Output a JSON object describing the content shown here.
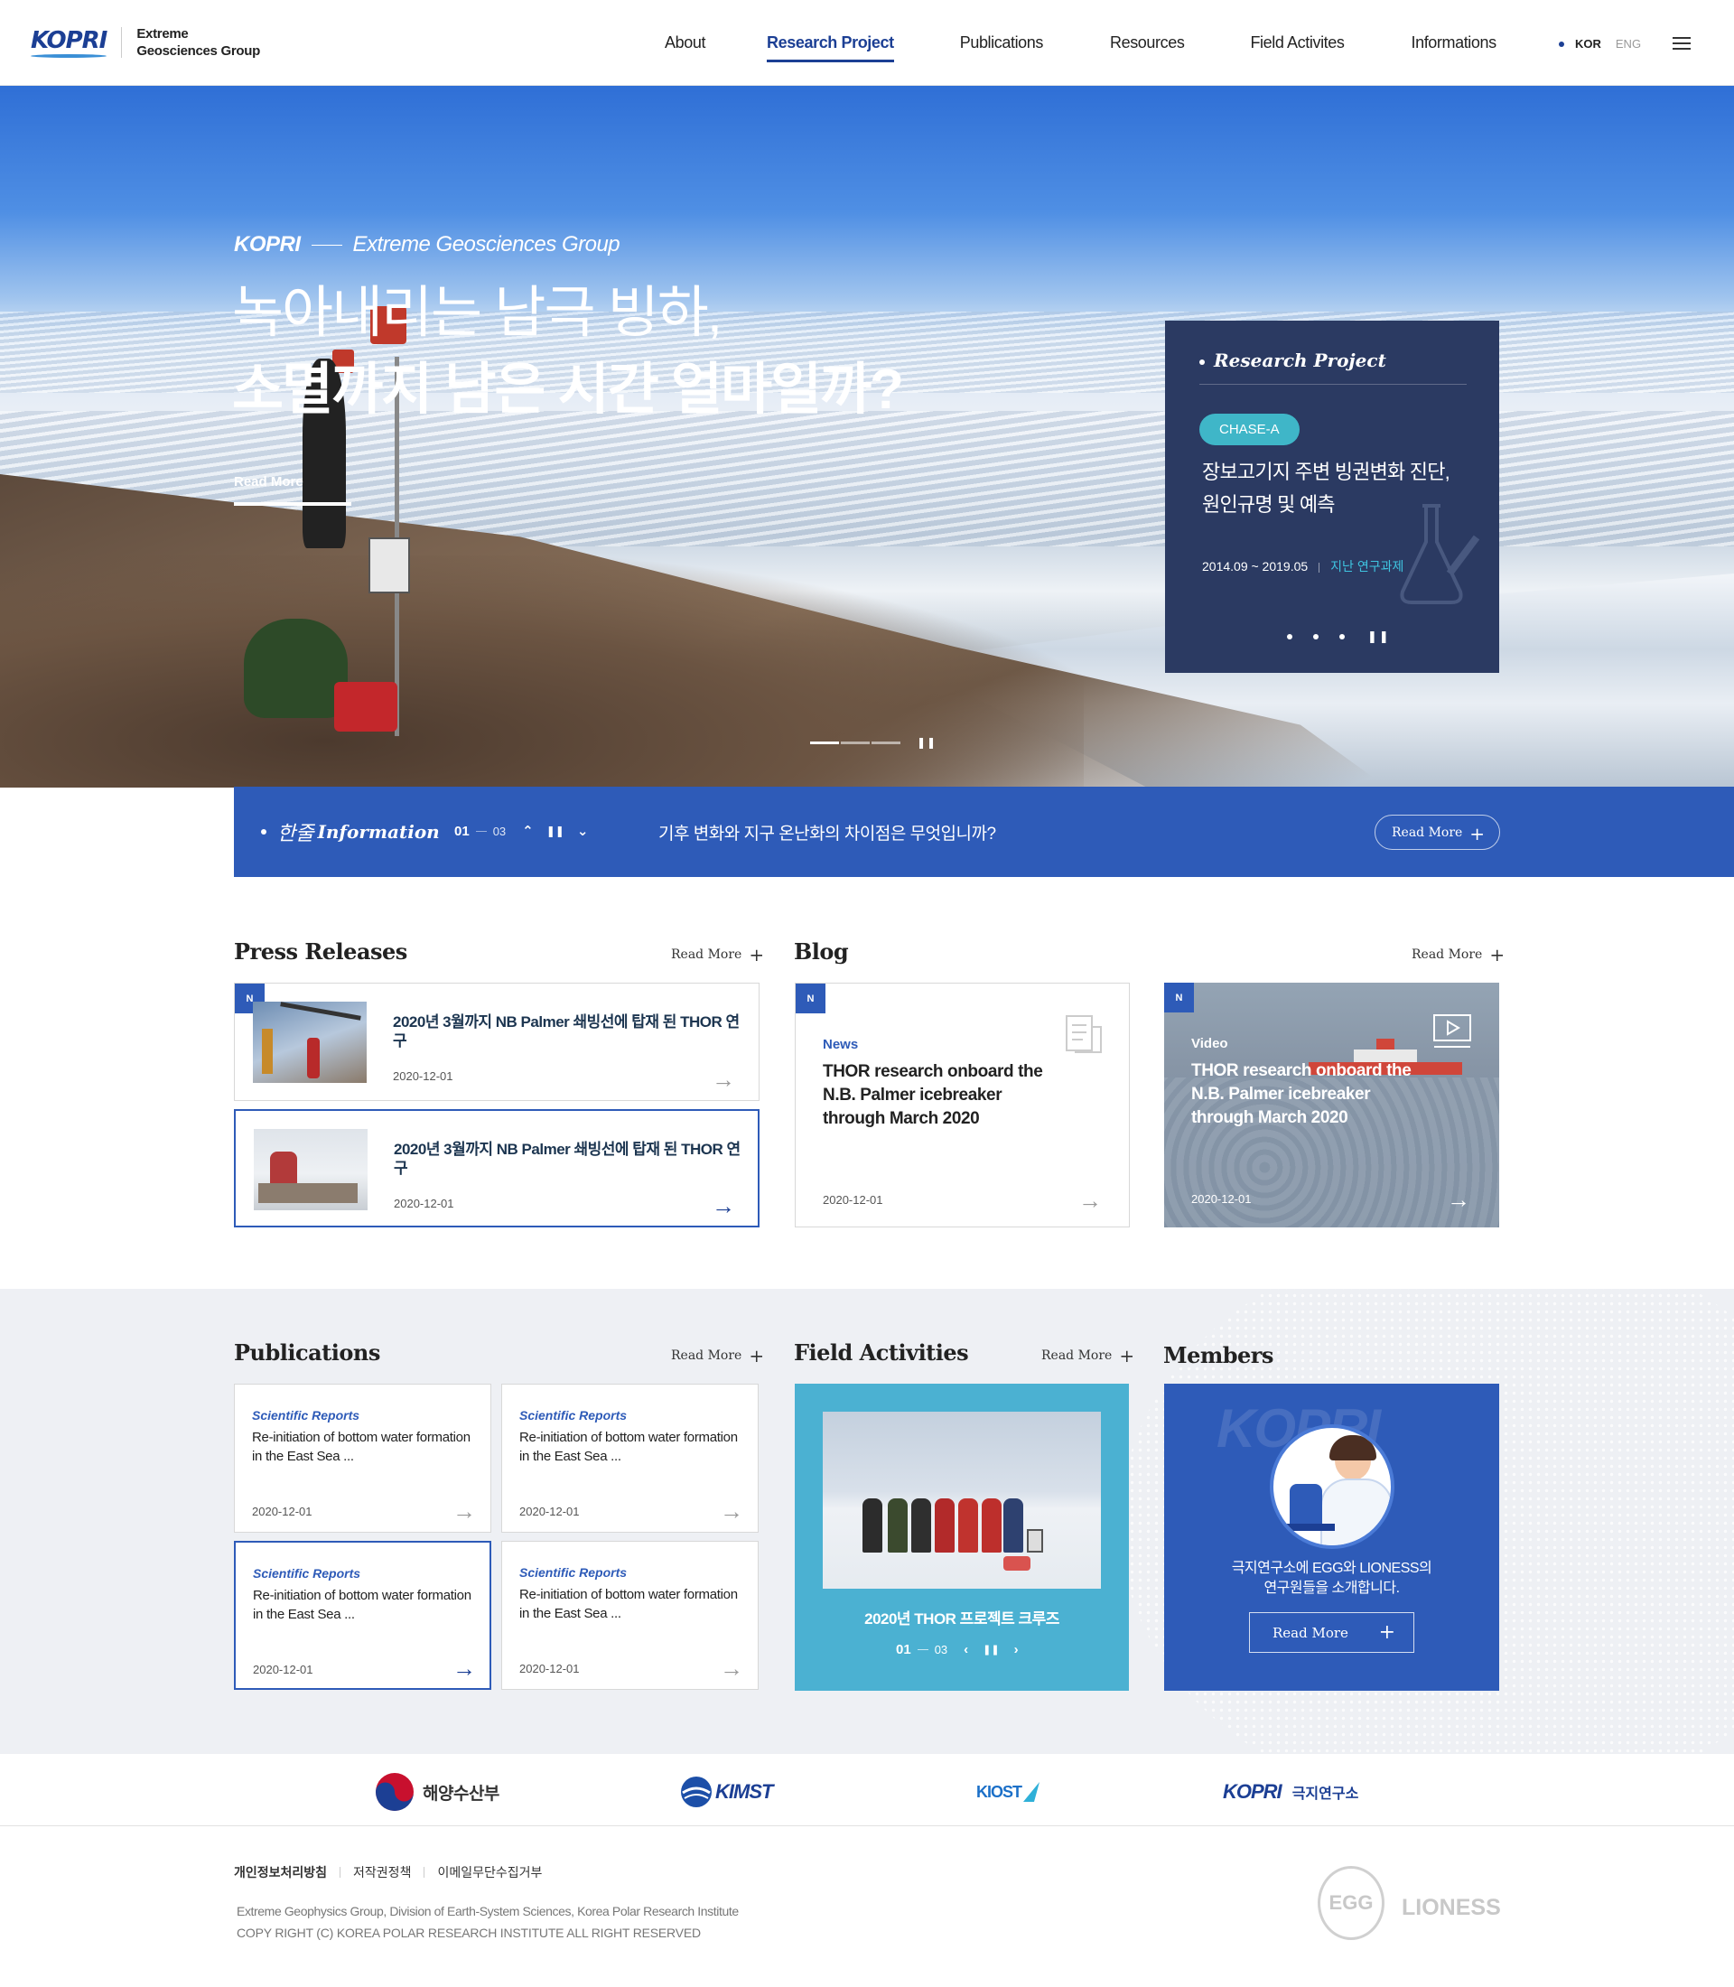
{
  "header": {
    "logo_mark": "KOPRI",
    "logo_text_line1": "Extreme",
    "logo_text_line2": "Geosciences Group",
    "nav": [
      "About",
      "Research Project",
      "Publications",
      "Resources",
      "Field Activites",
      "Informations"
    ],
    "active_nav_index": 1,
    "lang_kor": "KOR",
    "lang_eng": "ENG"
  },
  "hero": {
    "kicker_brand": "KOPRI",
    "kicker_group": "Extreme Geosciences Group",
    "title_line1": "녹아내리는 남극 빙하,",
    "title_line2": "소멸까지 남은 시간 얼마일까?",
    "read_more": "Read More",
    "slides_total": 3,
    "slide_current": 1,
    "research_card": {
      "heading": "Research Project",
      "tag": "CHASE-A",
      "title": "장보고기지 주변 빙권변화 진단, 원인규명 및 예측",
      "period": "2014.09 ~ 2019.05",
      "status": "지난 연구과제"
    }
  },
  "info_bar": {
    "label_hand": "한줄",
    "label_word": "Information",
    "current": "01",
    "total": "03",
    "text": "기후 변화와 지구 온난화의 차이점은 무엇입니까?",
    "read_more": "Read More"
  },
  "press": {
    "title": "Press Releases",
    "read_more": "Read More",
    "items": [
      {
        "badge": "N",
        "title": "2020년 3월까지 NB Palmer 쇄빙선에 탑재 된 THOR 연구",
        "date": "2020-12-01"
      },
      {
        "badge": "",
        "title": "2020년 3월까지 NB Palmer 쇄빙선에 탑재 된 THOR 연구",
        "date": "2020-12-01"
      }
    ]
  },
  "blog": {
    "title": "Blog",
    "read_more": "Read More",
    "items": [
      {
        "badge": "N",
        "category": "News",
        "title": "THOR research onboard the N.B. Palmer icebreaker through March 2020",
        "date": "2020-12-01",
        "icon": "document-icon"
      },
      {
        "badge": "N",
        "category": "Video",
        "title": "THOR research onboard the N.B. Palmer icebreaker through March 2020",
        "date": "2020-12-01",
        "icon": "video-icon"
      }
    ]
  },
  "publications": {
    "title": "Publications",
    "read_more": "Read More",
    "items": [
      {
        "category": "Scientific Reports",
        "title": "Re-initiation of bottom water formation in the East Sea ...",
        "date": "2020-12-01"
      },
      {
        "category": "Scientific Reports",
        "title": "Re-initiation of bottom water formation in the East Sea ...",
        "date": "2020-12-01"
      },
      {
        "category": "Scientific Reports",
        "title": "Re-initiation of bottom water formation in the East Sea ...",
        "date": "2020-12-01"
      },
      {
        "category": "Scientific Reports",
        "title": "Re-initiation of bottom water formation in the East Sea ...",
        "date": "2020-12-01"
      }
    ]
  },
  "field": {
    "title": "Field Activities",
    "read_more": "Read More",
    "caption": "2020년 THOR 프로젝트 크루즈",
    "current": "01",
    "total": "03"
  },
  "members": {
    "title": "Members",
    "watermark": "KOPRI",
    "text_line1": "극지연구소에 EGG와 LIONESS의",
    "text_line2": "연구원들을 소개합니다.",
    "read_more": "Read More"
  },
  "partners": [
    {
      "name": "해양수산부"
    },
    {
      "name": "KIMST"
    },
    {
      "name": "KIOST"
    },
    {
      "name": "KOPRI",
      "sub": "극지연구소"
    }
  ],
  "footer": {
    "links": [
      "개인정보처리방침",
      "저작권정책",
      "이메일무단수집거부"
    ],
    "address": "Extreme Geophysics Group, Division of Earth-System Sciences, Korea Polar Research Institute",
    "copyright": "COPY RIGHT (C) KOREA POLAR RESEARCH INSTITUTE ALL RIGHT RESERVED",
    "logo_egg": "EGG",
    "logo_lioness": "LIONESS"
  },
  "colors": {
    "brand_navy": "#1c3f94",
    "brand_blue": "#2e5bb8",
    "card_dark": "#2b3a62",
    "teal": "#4bb1d2",
    "tag_teal": "#3fb6c8"
  }
}
